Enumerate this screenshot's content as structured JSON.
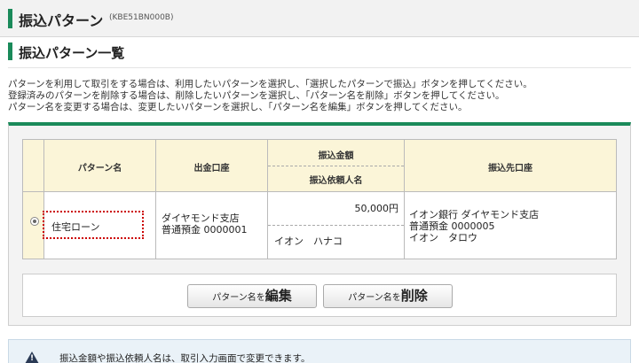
{
  "header": {
    "title": "振込パターン",
    "code": "(KBE51BN000B)"
  },
  "section": {
    "title": "振込パターン一覧"
  },
  "description": [
    "パターンを利用して取引をする場合は、利用したいパターンを選択し、「選択したパターンで振込」ボタンを押してください。",
    "登録済みのパターンを削除する場合は、削除したいパターンを選択し、「パターン名を削除」ボタンを押してください。",
    "パターン名を変更する場合は、変更したいパターンを選択し、「パターン名を編集」ボタンを押してください。"
  ],
  "table": {
    "headers": {
      "pattern_name": "パターン名",
      "source_account": "出金口座",
      "amount": "振込金額",
      "requester": "振込依頼人名",
      "destination": "振込先口座"
    },
    "row": {
      "selected": true,
      "pattern_name": "住宅ローン",
      "source_branch": "ダイヤモンド支店",
      "source_account": "普通預金 0000001",
      "amount": "50,000円",
      "requester": "イオン　ハナコ",
      "dest_bank": "イオン銀行 ダイヤモンド支店",
      "dest_account": "普通預金 0000005",
      "dest_name": "イオン　タロウ"
    }
  },
  "buttons": {
    "edit_prefix": "パターン名を",
    "edit_main": "編集",
    "delete_prefix": "パターン名を",
    "delete_main": "削除"
  },
  "note": {
    "text": "振込金額や振込依頼人名は、取引入力画面で変更できます。"
  },
  "colors": {
    "accent": "#1a8a5a",
    "header_cell": "#fbf5d8",
    "highlight": "#cc0000"
  }
}
